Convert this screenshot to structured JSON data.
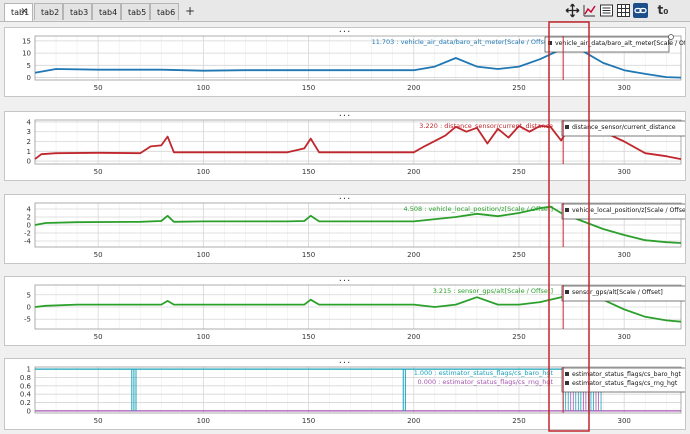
{
  "tabs": [
    {
      "label": "tab1",
      "active": true
    },
    {
      "label": "tab2"
    },
    {
      "label": "tab3"
    },
    {
      "label": "tab4"
    },
    {
      "label": "tab5"
    },
    {
      "label": "tab6"
    }
  ],
  "add_tab_label": "+",
  "tab_close_label": "✕",
  "toolbar": {
    "icons": [
      "move-icon",
      "chart-settings-icon",
      "legend-icon",
      "grid-icon",
      "link-icon",
      "time-offset-icon"
    ],
    "time_offset_label": "t₀"
  },
  "panel_menu_label": "···",
  "x_ticks": [
    50,
    100,
    150,
    200,
    250,
    300
  ],
  "chart_data": [
    {
      "type": "line",
      "x_range": [
        20,
        327
      ],
      "ylim": [
        -1,
        17
      ],
      "y_ticks": [
        0,
        5,
        10,
        15
      ],
      "grid": true,
      "value_readout": "11.703 : vehicle_air_data/baro_alt_meter[Scale / Offset]",
      "series": [
        {
          "name": "vehicle_air_data/baro_alt_meter[Scale / Offset]",
          "color": "#1f77b4",
          "x": [
            20,
            30,
            50,
            80,
            100,
            120,
            150,
            180,
            200,
            210,
            220,
            230,
            240,
            250,
            260,
            270,
            275,
            280,
            290,
            300,
            310,
            320,
            327
          ],
          "y": [
            2,
            3.5,
            3.2,
            3.2,
            2.8,
            3,
            3,
            3,
            3,
            4.5,
            8,
            4.5,
            3.5,
            4.5,
            7.5,
            11.5,
            16,
            11,
            6,
            3,
            1.5,
            0.2,
            0
          ]
        }
      ],
      "legend": "top-right"
    },
    {
      "type": "line",
      "x_range": [
        20,
        327
      ],
      "ylim": [
        -0.3,
        4.2
      ],
      "y_ticks": [
        0,
        1,
        2,
        3,
        4
      ],
      "grid": true,
      "value_readout": "3.220 : distance_sensor/current_distance",
      "series": [
        {
          "name": "distance_sensor/current_distance",
          "color": "#c0272d",
          "x": [
            20,
            23,
            30,
            50,
            70,
            75,
            80,
            83,
            86,
            100,
            140,
            148,
            151,
            155,
            200,
            205,
            215,
            220,
            225,
            230,
            235,
            240,
            245,
            250,
            255,
            260,
            265,
            270,
            275,
            280,
            285,
            290,
            300,
            310,
            320,
            327
          ],
          "y": [
            0.2,
            0.7,
            0.8,
            0.85,
            0.8,
            1.5,
            1.6,
            2.5,
            0.9,
            0.9,
            0.9,
            1.3,
            2.3,
            0.9,
            0.9,
            1.5,
            2.6,
            3.5,
            3,
            3.4,
            1.8,
            3.3,
            2.4,
            3.6,
            3,
            3.6,
            3.5,
            2.1,
            3.8,
            3.5,
            3.5,
            3,
            2,
            0.8,
            0.5,
            0.2
          ]
        }
      ],
      "legend": "top-right"
    },
    {
      "type": "line",
      "x_range": [
        20,
        327
      ],
      "ylim": [
        -5.5,
        5.5
      ],
      "y_ticks": [
        -4,
        -2,
        0,
        2,
        4
      ],
      "grid": true,
      "value_readout": "4.508 : vehicle_local_position/z[Scale / Offset]",
      "series": [
        {
          "name": "vehicle_local_position/z[Scale / Offset]",
          "color": "#2ca02c",
          "x": [
            20,
            25,
            40,
            70,
            80,
            83,
            86,
            100,
            140,
            148,
            151,
            155,
            200,
            220,
            230,
            240,
            250,
            260,
            265,
            270,
            280,
            290,
            300,
            310,
            320,
            327
          ],
          "y": [
            0,
            0.5,
            0.7,
            0.8,
            1,
            2.3,
            0.8,
            0.9,
            0.9,
            1,
            2.3,
            0.9,
            0.9,
            2,
            2.8,
            2.2,
            3,
            4.2,
            4.6,
            3,
            1,
            -1,
            -2.5,
            -3.8,
            -4.3,
            -4.5
          ]
        }
      ],
      "legend": "top-right"
    },
    {
      "type": "line",
      "x_range": [
        20,
        327
      ],
      "ylim": [
        -9,
        9
      ],
      "y_ticks": [
        -5,
        0,
        5
      ],
      "grid": true,
      "value_readout": "3.215 : sensor_gps/alt[Scale / Offset]",
      "series": [
        {
          "name": "sensor_gps/alt[Scale / Offset]",
          "color": "#2ca02c",
          "x": [
            20,
            25,
            40,
            70,
            80,
            83,
            86,
            100,
            140,
            148,
            151,
            155,
            200,
            210,
            220,
            230,
            240,
            250,
            260,
            270,
            275,
            280,
            290,
            300,
            310,
            320,
            327
          ],
          "y": [
            0,
            0.5,
            1,
            1,
            1,
            2.5,
            1,
            1,
            1,
            1,
            3,
            1,
            1,
            0,
            1,
            4,
            1,
            1,
            2,
            4,
            6,
            8,
            3,
            -1,
            -4,
            -5.5,
            -6
          ]
        }
      ],
      "legend": "top-right"
    },
    {
      "type": "line",
      "x_range": [
        20,
        327
      ],
      "ylim": [
        -0.05,
        1.05
      ],
      "y_ticks": [
        0,
        0.2,
        0.4,
        0.6,
        0.8,
        1
      ],
      "grid": true,
      "value_readouts": [
        "1.000 : estimator_status_flags/cs_baro_hgt",
        "0.000 : estimator_status_flags/cs_rng_hgt"
      ],
      "series": [
        {
          "name": "estimator_status_flags/cs_baro_hgt",
          "color": "#17a2b8"
        },
        {
          "name": "estimator_status_flags/cs_rng_hgt",
          "color": "#a455b0"
        }
      ],
      "legend": "top-right"
    }
  ],
  "legends": [
    [
      "vehicle_air_data/baro_alt_meter[Scale / Offset]"
    ],
    [
      "distance_sensor/current_distance"
    ],
    [
      "vehicle_local_position/z[Scale / Offset]"
    ],
    [
      "sensor_gps/alt[Scale / Offset]"
    ],
    [
      "estimator_status_flags/cs_baro_hgt",
      "estimator_status_flags/cs_rng_hgt"
    ]
  ],
  "colors": {
    "highlight_box": "#c0272d",
    "cursor_line": "#c0272d"
  },
  "highlight_range": [
    265,
    290
  ],
  "cursor_x": 271
}
